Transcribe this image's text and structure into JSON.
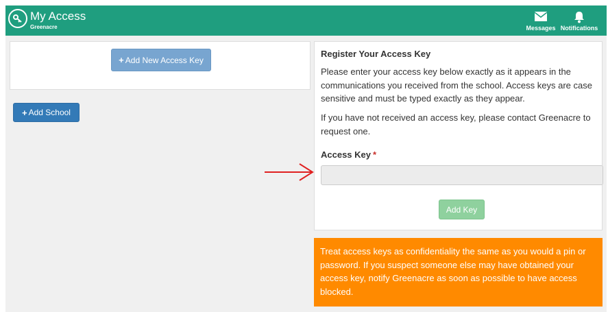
{
  "header": {
    "title": "My Access",
    "subtitle": "Greenacre",
    "messages_label": "Messages",
    "notifications_label": "Notifications"
  },
  "left": {
    "add_key_label": "Add New Access Key",
    "add_school_label": "Add School"
  },
  "register": {
    "title": "Register Your Access Key",
    "intro": "Please enter your access key below exactly as it appears in the communications you received from the school. Access keys are case sensitive and must be typed exactly as they appear.",
    "contact": "If you have not received an access key, please contact Greenacre to request one.",
    "field_label": "Access Key",
    "required_mark": "*",
    "field_value": "",
    "submit_label": "Add Key"
  },
  "warning": {
    "text": "Treat access keys as confidentiality the same as you would a pin or password. If you suspect someone else may have obtained your access key, notify Greenacre as soon as possible to have access blocked."
  },
  "colors": {
    "header": "#1f9e7f",
    "primary": "#337ab7",
    "success": "#8fd19e",
    "warning": "#ff8a00",
    "annotation_arrow": "#e02020"
  }
}
